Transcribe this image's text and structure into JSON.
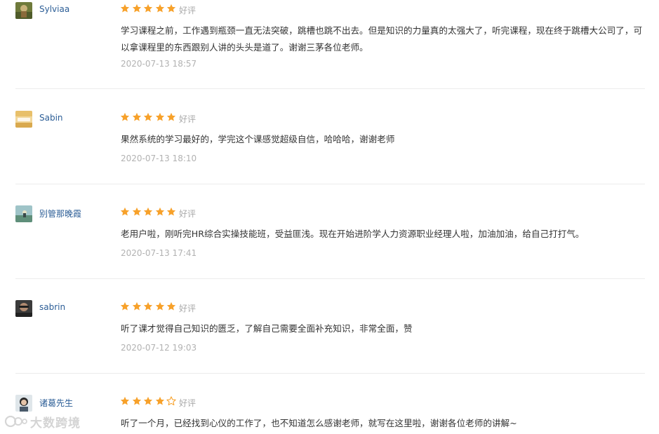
{
  "reviews": [
    {
      "username": "Sylviaa",
      "avatar_icon": "avatar-image",
      "rating": 5,
      "rating_label": "好评",
      "content": "学习课程之前，工作遇到瓶颈一直无法突破，跳槽也跳不出去。但是知识的力量真的太强大了，听完课程，现在终于跳槽大公司了，可以拿课程里的东西跟别人讲的头头是道了。谢谢三茅各位老师。",
      "date": "2020-07-13 18:57"
    },
    {
      "username": "Sabin",
      "avatar_icon": "avatar-image",
      "rating": 5,
      "rating_label": "好评",
      "content": "果然系统的学习最好的，学完这个课感觉超级自信，哈哈哈，谢谢老师",
      "date": "2020-07-13 18:10"
    },
    {
      "username": "别管那晚霞",
      "avatar_icon": "avatar-image",
      "rating": 5,
      "rating_label": "好评",
      "content": "老用户啦，刚听完HR综合实操技能班，受益匪浅。现在开始进阶学人力资源职业经理人啦，加油加油，给自己打打气。",
      "date": "2020-07-13 17:41"
    },
    {
      "username": "sabrin",
      "avatar_icon": "avatar-image",
      "rating": 5,
      "rating_label": "好评",
      "content": "听了课才觉得自己知识的匮乏，了解自己需要全面补充知识，非常全面，赞",
      "date": "2020-07-12 19:03"
    },
    {
      "username": "诸葛先生",
      "avatar_icon": "avatar-image",
      "rating": 4,
      "rating_label": "好评",
      "content": "听了一个月，已经找到心仪的工作了，也不知道怎么感谢老师，就写在这里啦，谢谢各位老师的讲解~",
      "date": ""
    }
  ],
  "watermark": {
    "text": "大数跨境",
    "icon": "watermark-logo-icon"
  },
  "colors": {
    "star_filled": "#f7a12a",
    "star_empty": "#f7a12a",
    "username": "#2b5d96",
    "muted": "#aaaaaa",
    "divider": "#ececec"
  }
}
